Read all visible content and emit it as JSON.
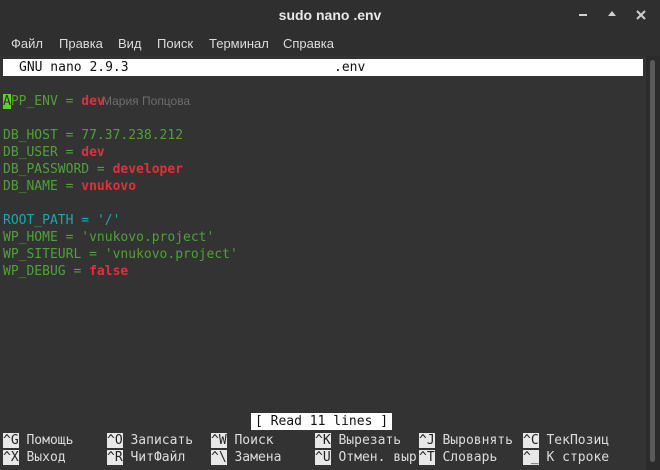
{
  "window": {
    "title": "sudo nano .env"
  },
  "menu": [
    "Файл",
    "Правка",
    "Вид",
    "Поиск",
    "Терминал",
    "Справка"
  ],
  "nano": {
    "version": "GNU nano 2.9.3",
    "filename": ".env",
    "ghost_text": "Мария Попцова",
    "lines": [
      {
        "key": "APP_ENV",
        "value": "dev"
      },
      {
        "key": "DB_HOST",
        "value": "77.37.238.212"
      },
      {
        "key": "DB_USER",
        "value": "dev"
      },
      {
        "key": "DB_PASSWORD",
        "value": "developer"
      },
      {
        "key": "DB_NAME",
        "value": "vnukovo"
      },
      {
        "key": "ROOT_PATH",
        "value": "'/'"
      },
      {
        "key": "WP_HOME",
        "value": "'vnukovo.project'"
      },
      {
        "key": "WP_SITEURL",
        "value": "'vnukovo.project'"
      },
      {
        "key": "WP_DEBUG",
        "value": "false"
      }
    ],
    "status": "[ Read 11 lines ]",
    "shortcuts": [
      {
        "key": "^G",
        "label": "Помощь"
      },
      {
        "key": "^O",
        "label": "Записать"
      },
      {
        "key": "^W",
        "label": "Поиск"
      },
      {
        "key": "^K",
        "label": "Вырезать"
      },
      {
        "key": "^J",
        "label": "Выровнять"
      },
      {
        "key": "^C",
        "label": "ТекПозиц"
      },
      {
        "key": "^X",
        "label": "Выход"
      },
      {
        "key": "^R",
        "label": "ЧитФайл"
      },
      {
        "key": "^\\",
        "label": "Замена"
      },
      {
        "key": "^U",
        "label": "Отмен. выр"
      },
      {
        "key": "^T",
        "label": "Словарь"
      },
      {
        "key": "^_",
        "label": "К строке"
      }
    ]
  },
  "colors": {
    "background": "#333333",
    "key_green": "#50a03a",
    "key_cyan": "#1aa7b2",
    "value_red": "#e1303a",
    "cursor": "#5fd129"
  }
}
